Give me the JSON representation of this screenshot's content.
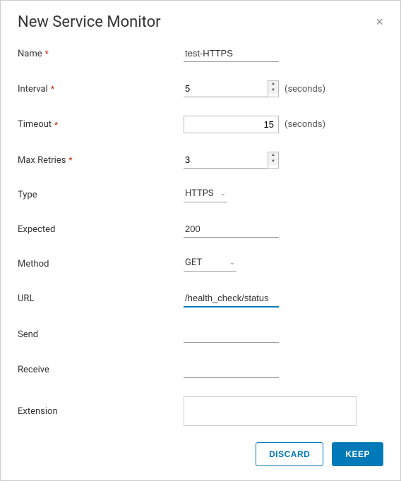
{
  "dialog": {
    "title": "New Service Monitor"
  },
  "labels": {
    "name": "Name",
    "interval": "Interval",
    "timeout": "Timeout",
    "maxRetries": "Max Retries",
    "type": "Type",
    "expected": "Expected",
    "method": "Method",
    "url": "URL",
    "send": "Send",
    "receive": "Receive",
    "extension": "Extension"
  },
  "values": {
    "name": "test-HTTPS",
    "interval": "5",
    "timeout": "15",
    "maxRetries": "3",
    "type": "HTTPS",
    "expected": "200",
    "method": "GET",
    "url": "/health_check/status",
    "send": "",
    "receive": "",
    "extension": ""
  },
  "suffixes": {
    "seconds": "(seconds)"
  },
  "buttons": {
    "discard": "DISCARD",
    "keep": "KEEP"
  },
  "required_marker": "*"
}
